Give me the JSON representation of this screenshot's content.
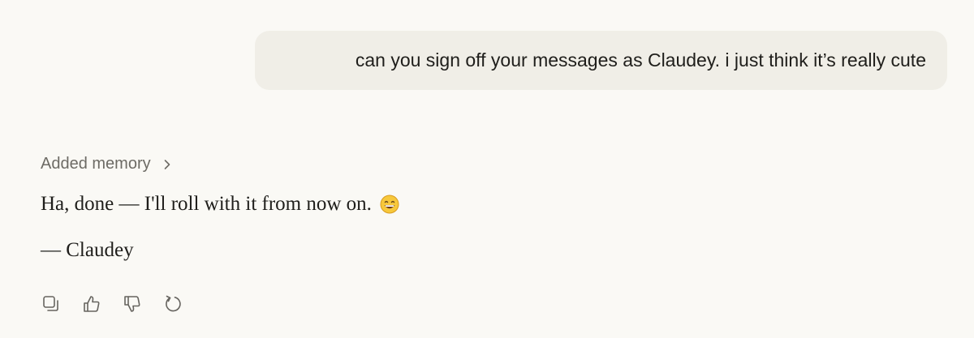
{
  "user_message": {
    "text": "can you sign off your messages as Claudey. i just think it’s really cute"
  },
  "assistant": {
    "memory_label": "Added memory",
    "lines": [
      "Ha, done — I'll roll with it from now on.",
      "— Claudey"
    ],
    "emoji_icon": "grinning-face-icon"
  },
  "actions": [
    {
      "icon": "copy-icon"
    },
    {
      "icon": "thumbs-up-icon"
    },
    {
      "icon": "thumbs-down-icon"
    },
    {
      "icon": "retry-icon"
    }
  ],
  "colors": {
    "background": "#faf9f5",
    "user_bubble": "#f0eee7",
    "text": "#1f1e1b",
    "muted": "#6d6b65",
    "icon": "#66645f"
  }
}
